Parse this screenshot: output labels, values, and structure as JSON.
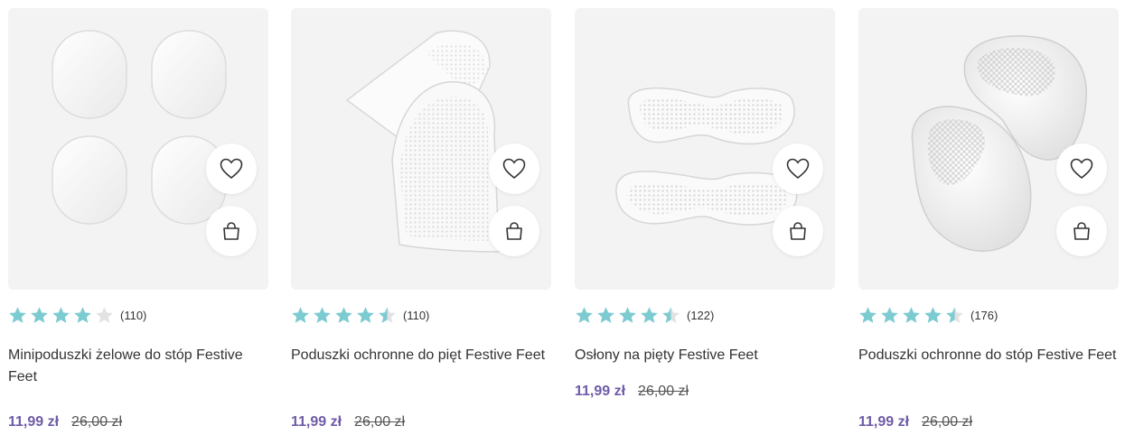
{
  "colors": {
    "image_bg": "#f3f3f3",
    "star_filled": "#7ccbd1",
    "star_empty": "#e2e2e2",
    "price_accent": "#6f5ba7"
  },
  "products": [
    {
      "name": "Minipoduszki żelowe do stóp Festive Feet",
      "rating": 4.0,
      "review_count": "(110)",
      "price": "11,99 zł",
      "old_price": "26,00 zł",
      "wishlist_icon": "heart-icon",
      "cart_icon": "shopping-bag-icon"
    },
    {
      "name": "Poduszki ochronne do pięt Festive Feet",
      "rating": 4.5,
      "review_count": "(110)",
      "price": "11,99 zł",
      "old_price": "26,00 zł",
      "wishlist_icon": "heart-icon",
      "cart_icon": "shopping-bag-icon"
    },
    {
      "name": "Osłony na pięty Festive Feet",
      "rating": 4.5,
      "review_count": "(122)",
      "price": "11,99 zł",
      "old_price": "26,00 zł",
      "wishlist_icon": "heart-icon",
      "cart_icon": "shopping-bag-icon"
    },
    {
      "name": "Poduszki ochronne do stóp Festive Feet",
      "rating": 4.5,
      "review_count": "(176)",
      "price": "11,99 zł",
      "old_price": "26,00 zł",
      "wishlist_icon": "heart-icon",
      "cart_icon": "shopping-bag-icon"
    }
  ]
}
